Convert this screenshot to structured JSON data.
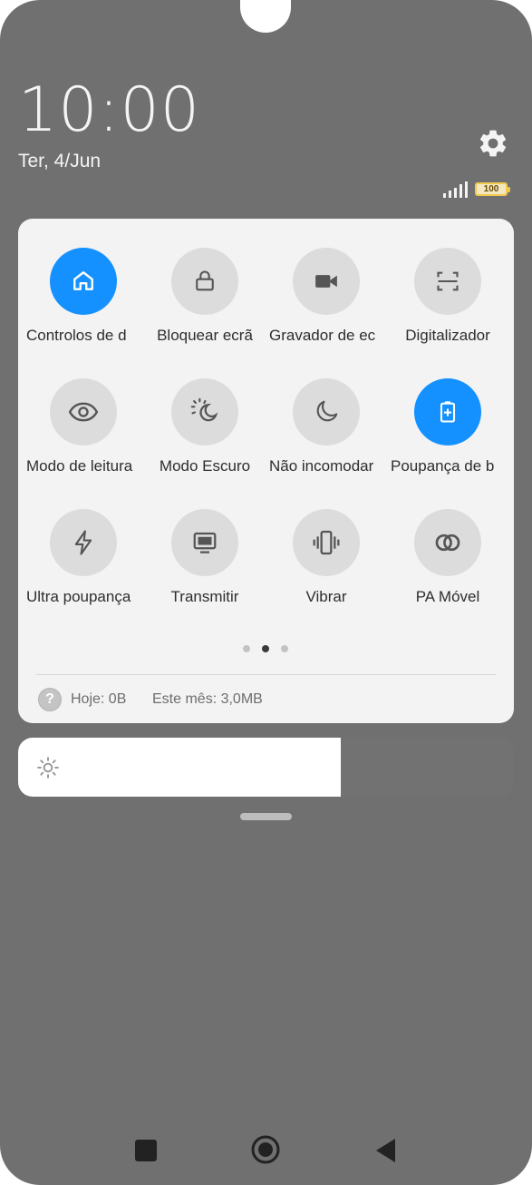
{
  "status": {
    "time": "10:00",
    "date": "Ter, 4/Jun",
    "battery": "100",
    "battery_color": "#f2c94c"
  },
  "quick_settings": {
    "accent_color": "#1591ff",
    "tiles": [
      {
        "label": "Controlos de d",
        "icon": "home-icon",
        "active": true
      },
      {
        "label": "Bloquear ecrã",
        "icon": "lock-icon",
        "active": false
      },
      {
        "label": "Gravador de ec",
        "icon": "video-camera-icon",
        "active": false
      },
      {
        "label": "Digitalizador",
        "icon": "scan-icon",
        "active": false
      },
      {
        "label": "Modo de leitura",
        "icon": "eye-icon",
        "active": false
      },
      {
        "label": "Modo Escuro",
        "icon": "sun-moon-icon",
        "active": false
      },
      {
        "label": "Não incomodar",
        "icon": "moon-icon",
        "active": false
      },
      {
        "label": "Poupança de b",
        "icon": "battery-saver-icon",
        "active": true
      },
      {
        "label": "Ultra poupança",
        "icon": "lightning-icon",
        "active": false
      },
      {
        "label": "Transmitir",
        "icon": "monitor-icon",
        "active": false
      },
      {
        "label": "Vibrar",
        "icon": "vibrate-icon",
        "active": false
      },
      {
        "label": "PA Móvel",
        "icon": "hotspot-link-icon",
        "active": false
      }
    ],
    "page_indicator": {
      "pages": 3,
      "current": 2
    }
  },
  "data_usage": {
    "today": "Hoje: 0B",
    "month": "Este mês: 3,0MB"
  },
  "brightness": {
    "level": 0.65
  },
  "navigation": {
    "recents": "square-icon",
    "home": "circle-home-icon",
    "back": "back-triangle-icon"
  }
}
